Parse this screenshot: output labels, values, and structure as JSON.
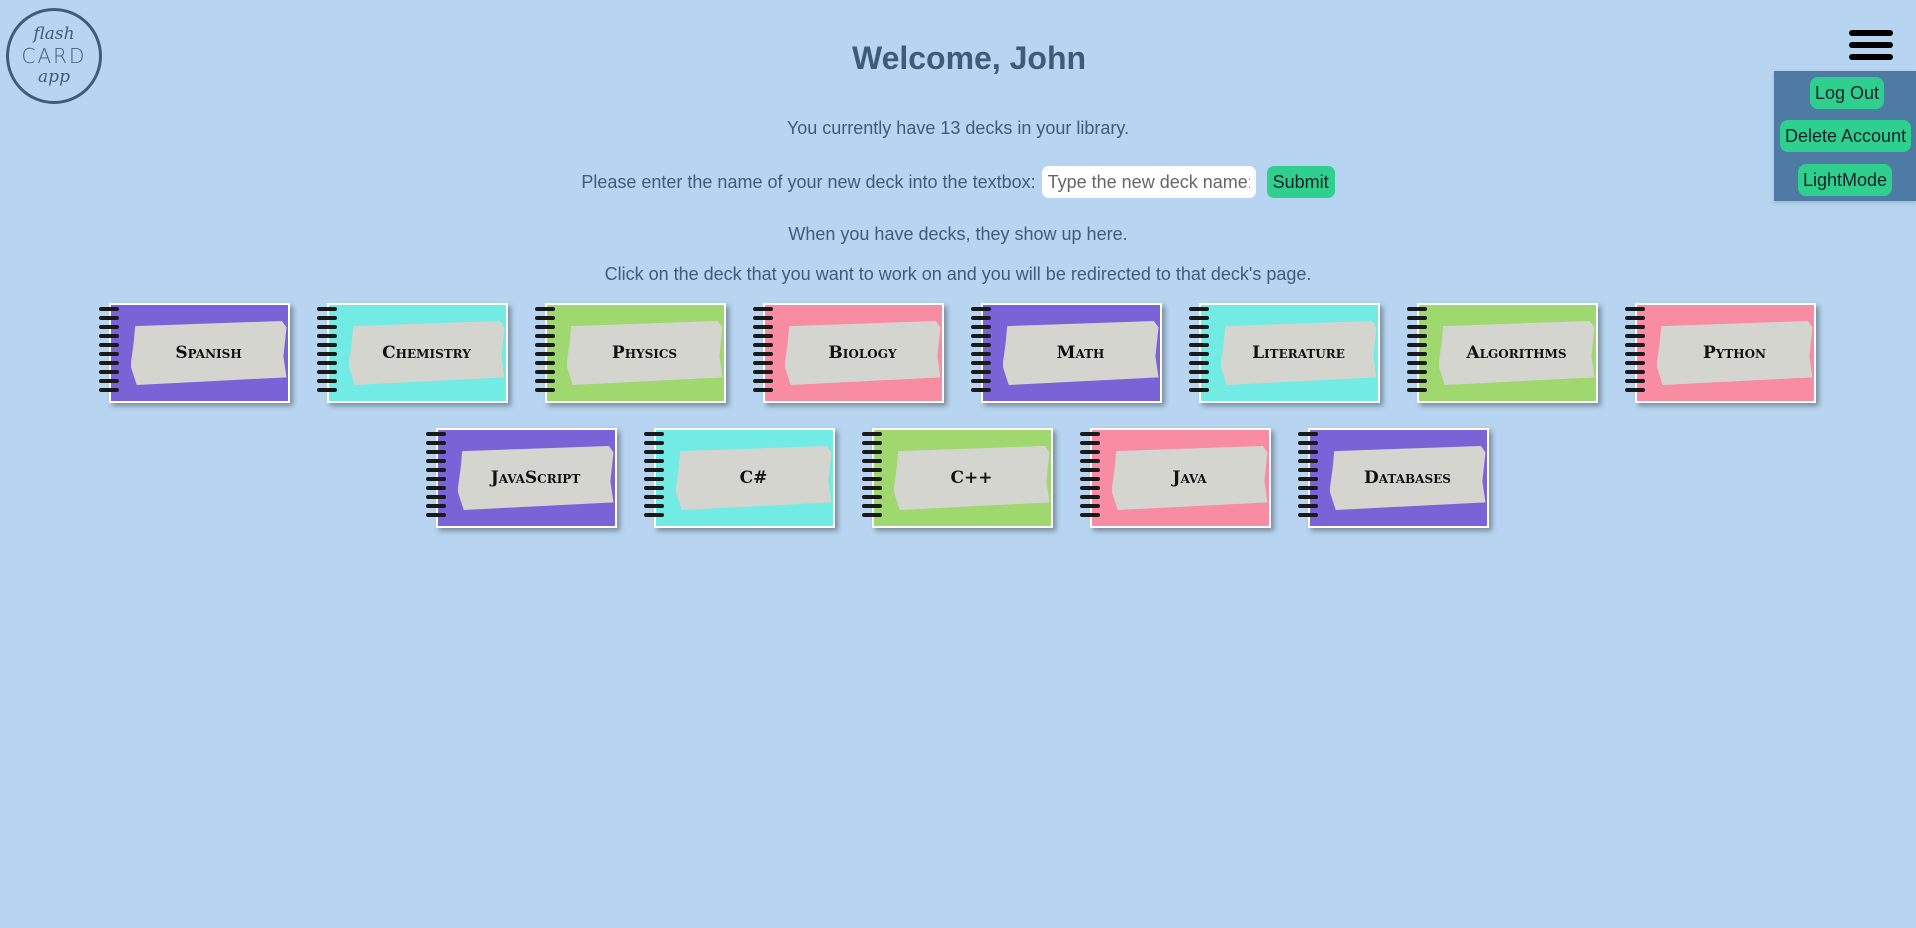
{
  "logo": {
    "line1": "flash",
    "line2": "CARD",
    "line3": "app"
  },
  "header": {
    "title": "Welcome, John"
  },
  "info": {
    "deck_count_text": "You currently have 13 decks in your library.",
    "prompt_label": "Please enter the name of your new deck into the textbox:",
    "input_placeholder": "Type the new deck name:",
    "submit_label": "Submit",
    "decks_note": "When you have decks, they show up here.",
    "click_note": "Click on the deck that you want to work on and you will be redirected to that deck's page."
  },
  "menu": {
    "logout_label": "Log Out",
    "delete_label": "Delete Account",
    "mode_label": "LightMode"
  },
  "colors": {
    "purple": "#7a63d6",
    "teal": "#72ebe4",
    "green": "#a0d870",
    "pink": "#f88ca2",
    "accent": "#2fcf8e"
  },
  "decks": [
    {
      "name": "Spanish",
      "color": "#7a63d6"
    },
    {
      "name": "Chemistry",
      "color": "#72ebe4"
    },
    {
      "name": "Physics",
      "color": "#a0d870"
    },
    {
      "name": "Biology",
      "color": "#f88ca2"
    },
    {
      "name": "Math",
      "color": "#7a63d6"
    },
    {
      "name": "Literature",
      "color": "#72ebe4"
    },
    {
      "name": "Algorithms",
      "color": "#a0d870"
    },
    {
      "name": "Python",
      "color": "#f88ca2"
    },
    {
      "name": "JavaScript",
      "color": "#7a63d6"
    },
    {
      "name": "C#",
      "color": "#72ebe4"
    },
    {
      "name": "C++",
      "color": "#a0d870"
    },
    {
      "name": "Java",
      "color": "#f88ca2"
    },
    {
      "name": "Databases",
      "color": "#7a63d6"
    }
  ]
}
